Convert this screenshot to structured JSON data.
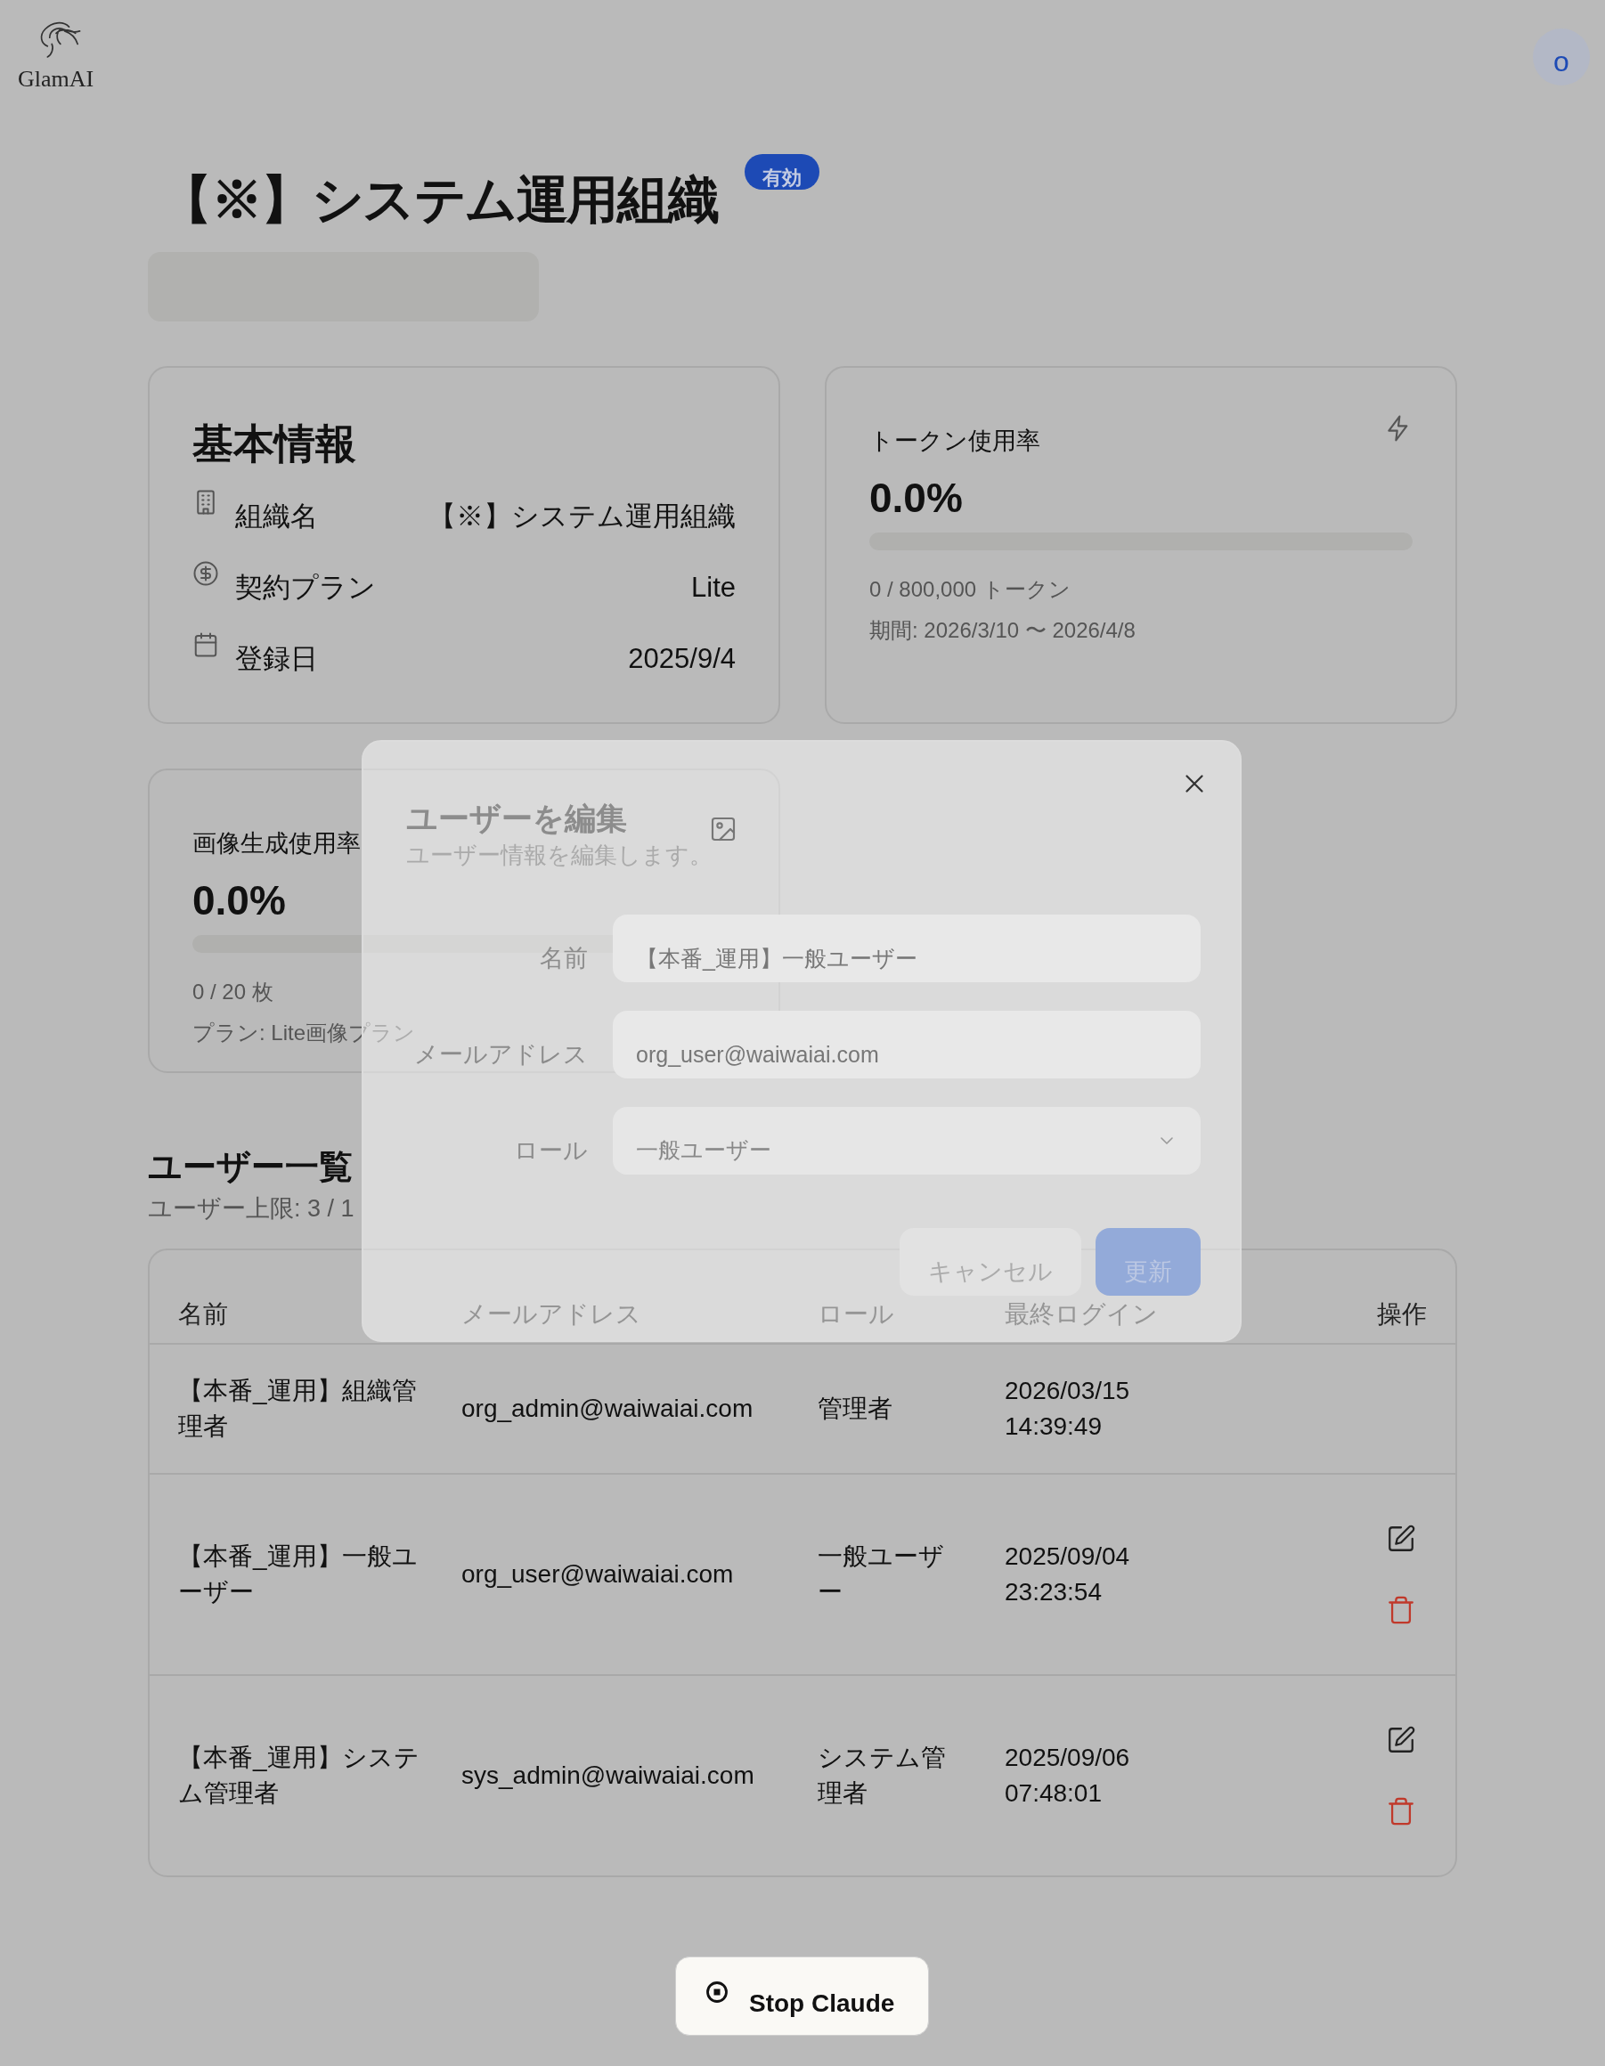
{
  "header": {
    "logo": "GlamAI",
    "avatar": "o"
  },
  "organization": {
    "title": "【※】システム運用組織",
    "status": "有効"
  },
  "basic_info": {
    "title": "基本情報",
    "rows": [
      {
        "kind": "building",
        "label": "組織名",
        "value": "【※】システム運用組織"
      },
      {
        "kind": "dollar",
        "label": "契約プラン",
        "value": "Lite"
      },
      {
        "kind": "calendar",
        "label": "登録日",
        "value": "2025/9/4"
      }
    ]
  },
  "token_usage": {
    "title": "トークン使用率",
    "percent": "0.0%",
    "level": 0,
    "count": "0 / 800,000 トークン",
    "period": "期間: 2026/3/10 〜 2026/4/8"
  },
  "image_usage": {
    "title": "画像生成使用率",
    "percent": "0.0%",
    "level": 0,
    "count": "0 / 20 枚",
    "plan": "プラン: Lite画像プラン"
  },
  "users": {
    "title": "ユーザー一覧",
    "limit": "ユーザー上限: 3 / 1",
    "columns": [
      "名前",
      "メールアドレス",
      "ロール",
      "最終ログイン",
      "操作"
    ],
    "rows": [
      {
        "name": "【本番_運用】組織管理者",
        "email": "org_admin@waiwaiai.com",
        "role": "管理者",
        "last_login": "2026/03/15 14:39:49",
        "actions": false
      },
      {
        "name": "【本番_運用】一般ユーザー",
        "email": "org_user@waiwaiai.com",
        "role": "一般ユーザー",
        "last_login": "2025/09/04 23:23:54",
        "actions": true
      },
      {
        "name": "【本番_運用】システム管理者",
        "email": "sys_admin@waiwaiai.com",
        "role": "システム管理者",
        "last_login": "2025/09/06 07:48:01",
        "actions": true
      }
    ]
  },
  "dialog": {
    "title": "ユーザーを編集",
    "subtitle": "ユーザー情報を編集します。",
    "fields": [
      {
        "kind": "text",
        "label": "名前",
        "value": "【本番_運用】一般ユーザー"
      },
      {
        "kind": "text",
        "label": "メールアドレス",
        "value": "org_user@waiwaiai.com"
      },
      {
        "kind": "select",
        "label": "ロール",
        "value": "一般ユーザー"
      }
    ],
    "cancel": "キャンセル",
    "submit": "更新"
  },
  "stop_button": "Stop Claude"
}
